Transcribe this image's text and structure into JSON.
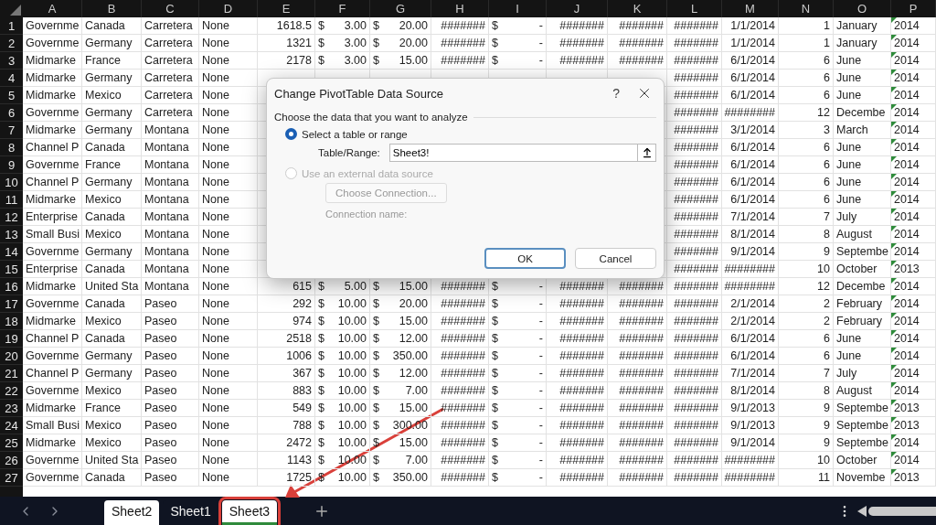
{
  "sheet": {
    "columns": [
      {
        "letter": "A"
      },
      {
        "letter": "B"
      },
      {
        "letter": "C"
      },
      {
        "letter": "D"
      },
      {
        "letter": "E"
      },
      {
        "letter": "F"
      },
      {
        "letter": "G"
      },
      {
        "letter": "H"
      },
      {
        "letter": "I"
      },
      {
        "letter": "J"
      },
      {
        "letter": "K"
      },
      {
        "letter": "L"
      },
      {
        "letter": "M"
      },
      {
        "letter": "N"
      },
      {
        "letter": "O"
      },
      {
        "letter": "P",
        "flagged": true
      }
    ],
    "rows": [
      {
        "number": "1",
        "cells": [
          "Governme",
          "Canada",
          "Carretera",
          "None",
          "1618.5",
          [
            "$",
            "3.00"
          ],
          [
            "$",
            "20.00"
          ],
          "#######",
          [
            "$",
            "-"
          ],
          "#######",
          "#######",
          "#######",
          "1/1/2014",
          "1",
          "January",
          "2014"
        ]
      },
      {
        "number": "2",
        "cells": [
          "Governme",
          "Germany",
          "Carretera",
          "None",
          "1321",
          [
            "$",
            "3.00"
          ],
          [
            "$",
            "20.00"
          ],
          "#######",
          [
            "$",
            "-"
          ],
          "#######",
          "#######",
          "#######",
          "1/1/2014",
          "1",
          "January",
          "2014"
        ]
      },
      {
        "number": "3",
        "cells": [
          "Midmarke",
          "France",
          "Carretera",
          "None",
          "2178",
          [
            "$",
            "3.00"
          ],
          [
            "$",
            "15.00"
          ],
          "#######",
          [
            "$",
            "-"
          ],
          "#######",
          "#######",
          "#######",
          "6/1/2014",
          "6",
          "June",
          "2014"
        ]
      },
      {
        "number": "4",
        "cells": [
          "Midmarke",
          "Germany",
          "Carretera",
          "None",
          null,
          null,
          null,
          null,
          null,
          null,
          null,
          "#######",
          "6/1/2014",
          "6",
          "June",
          "2014"
        ]
      },
      {
        "number": "5",
        "cells": [
          "Midmarke",
          "Mexico",
          "Carretera",
          "None",
          null,
          null,
          null,
          null,
          null,
          null,
          null,
          "#######",
          "6/1/2014",
          "6",
          "June",
          "2014"
        ]
      },
      {
        "number": "6",
        "cells": [
          "Governme",
          "Germany",
          "Carretera",
          "None",
          null,
          null,
          null,
          null,
          null,
          null,
          null,
          "#######",
          "########",
          "12",
          "Decembe",
          "2014"
        ]
      },
      {
        "number": "7",
        "cells": [
          "Midmarke",
          "Germany",
          "Montana",
          "None",
          null,
          null,
          null,
          null,
          null,
          null,
          null,
          "#######",
          "3/1/2014",
          "3",
          "March",
          "2014"
        ]
      },
      {
        "number": "8",
        "cells": [
          "Channel P",
          "Canada",
          "Montana",
          "None",
          null,
          null,
          null,
          null,
          null,
          null,
          null,
          "#######",
          "6/1/2014",
          "6",
          "June",
          "2014"
        ]
      },
      {
        "number": "9",
        "cells": [
          "Governme",
          "France",
          "Montana",
          "None",
          null,
          null,
          null,
          null,
          null,
          null,
          null,
          "#######",
          "6/1/2014",
          "6",
          "June",
          "2014"
        ]
      },
      {
        "number": "10",
        "cells": [
          "Channel P",
          "Germany",
          "Montana",
          "None",
          null,
          null,
          null,
          null,
          null,
          null,
          null,
          "#######",
          "6/1/2014",
          "6",
          "June",
          "2014"
        ]
      },
      {
        "number": "11",
        "cells": [
          "Midmarke",
          "Mexico",
          "Montana",
          "None",
          null,
          null,
          null,
          null,
          null,
          null,
          null,
          "#######",
          "6/1/2014",
          "6",
          "June",
          "2014"
        ]
      },
      {
        "number": "12",
        "cells": [
          "Enterprise",
          "Canada",
          "Montana",
          "None",
          null,
          null,
          null,
          null,
          null,
          null,
          null,
          "#######",
          "7/1/2014",
          "7",
          "July",
          "2014"
        ]
      },
      {
        "number": "13",
        "cells": [
          "Small Busi",
          "Mexico",
          "Montana",
          "None",
          null,
          null,
          null,
          null,
          null,
          null,
          null,
          "#######",
          "8/1/2014",
          "8",
          "August",
          "2014"
        ]
      },
      {
        "number": "14",
        "cells": [
          "Governme",
          "Germany",
          "Montana",
          "None",
          null,
          null,
          null,
          null,
          null,
          null,
          null,
          "#######",
          "9/1/2014",
          "9",
          "Septembe",
          "2014"
        ]
      },
      {
        "number": "15",
        "cells": [
          "Enterprise",
          "Canada",
          "Montana",
          "None",
          null,
          null,
          null,
          null,
          null,
          null,
          null,
          "#######",
          "########",
          "10",
          "October",
          "2013"
        ]
      },
      {
        "number": "16",
        "cells": [
          "Midmarke",
          "United Sta",
          "Montana",
          "None",
          "615",
          [
            "$",
            "5.00"
          ],
          [
            "$",
            "15.00"
          ],
          "#######",
          [
            "$",
            "-"
          ],
          "#######",
          "#######",
          "#######",
          "########",
          "12",
          "Decembe",
          "2014"
        ]
      },
      {
        "number": "17",
        "cells": [
          "Governme",
          "Canada",
          "Paseo",
          "None",
          "292",
          [
            "$",
            "10.00"
          ],
          [
            "$",
            "20.00"
          ],
          "#######",
          [
            "$",
            "-"
          ],
          "#######",
          "#######",
          "#######",
          "2/1/2014",
          "2",
          "February",
          "2014"
        ]
      },
      {
        "number": "18",
        "cells": [
          "Midmarke",
          "Mexico",
          "Paseo",
          "None",
          "974",
          [
            "$",
            "10.00"
          ],
          [
            "$",
            "15.00"
          ],
          "#######",
          [
            "$",
            "-"
          ],
          "#######",
          "#######",
          "#######",
          "2/1/2014",
          "2",
          "February",
          "2014"
        ]
      },
      {
        "number": "19",
        "cells": [
          "Channel P",
          "Canada",
          "Paseo",
          "None",
          "2518",
          [
            "$",
            "10.00"
          ],
          [
            "$",
            "12.00"
          ],
          "#######",
          [
            "$",
            "-"
          ],
          "#######",
          "#######",
          "#######",
          "6/1/2014",
          "6",
          "June",
          "2014"
        ]
      },
      {
        "number": "20",
        "cells": [
          "Governme",
          "Germany",
          "Paseo",
          "None",
          "1006",
          [
            "$",
            "10.00"
          ],
          [
            "$",
            "350.00"
          ],
          "#######",
          [
            "$",
            "-"
          ],
          "#######",
          "#######",
          "#######",
          "6/1/2014",
          "6",
          "June",
          "2014"
        ]
      },
      {
        "number": "21",
        "cells": [
          "Channel P",
          "Germany",
          "Paseo",
          "None",
          "367",
          [
            "$",
            "10.00"
          ],
          [
            "$",
            "12.00"
          ],
          "#######",
          [
            "$",
            "-"
          ],
          "#######",
          "#######",
          "#######",
          "7/1/2014",
          "7",
          "July",
          "2014"
        ]
      },
      {
        "number": "22",
        "cells": [
          "Governme",
          "Mexico",
          "Paseo",
          "None",
          "883",
          [
            "$",
            "10.00"
          ],
          [
            "$",
            "7.00"
          ],
          "#######",
          [
            "$",
            "-"
          ],
          "#######",
          "#######",
          "#######",
          "8/1/2014",
          "8",
          "August",
          "2014"
        ]
      },
      {
        "number": "23",
        "cells": [
          "Midmarke",
          "France",
          "Paseo",
          "None",
          "549",
          [
            "$",
            "10.00"
          ],
          [
            "$",
            "15.00"
          ],
          "#######",
          [
            "$",
            "-"
          ],
          "#######",
          "#######",
          "#######",
          "9/1/2013",
          "9",
          "Septembe",
          "2013"
        ]
      },
      {
        "number": "24",
        "cells": [
          "Small Busi",
          "Mexico",
          "Paseo",
          "None",
          "788",
          [
            "$",
            "10.00"
          ],
          [
            "$",
            "300.00"
          ],
          "#######",
          [
            "$",
            "-"
          ],
          "#######",
          "#######",
          "#######",
          "9/1/2013",
          "9",
          "Septembe",
          "2013"
        ]
      },
      {
        "number": "25",
        "cells": [
          "Midmarke",
          "Mexico",
          "Paseo",
          "None",
          "2472",
          [
            "$",
            "10.00"
          ],
          [
            "$",
            "15.00"
          ],
          "#######",
          [
            "$",
            "-"
          ],
          "#######",
          "#######",
          "#######",
          "9/1/2014",
          "9",
          "Septembe",
          "2014"
        ]
      },
      {
        "number": "26",
        "cells": [
          "Governme",
          "United Sta",
          "Paseo",
          "None",
          "1143",
          [
            "$",
            "10.00"
          ],
          [
            "$",
            "7.00"
          ],
          "#######",
          [
            "$",
            "-"
          ],
          "#######",
          "#######",
          "#######",
          "########",
          "10",
          "October",
          "2014"
        ]
      },
      {
        "number": "27",
        "cells": [
          "Governme",
          "Canada",
          "Paseo",
          "None",
          "1725",
          [
            "$",
            "10.00"
          ],
          [
            "$",
            "350.00"
          ],
          "#######",
          [
            "$",
            "-"
          ],
          "#######",
          "#######",
          "#######",
          "########",
          "11",
          "Novembe",
          "2013"
        ]
      }
    ]
  },
  "dialog": {
    "title": "Change PivotTable Data Source",
    "help": "?",
    "section_label": "Choose the data that you want to analyze",
    "options": [
      {
        "label": "Select a table or range",
        "selected": true,
        "disabled": false
      },
      {
        "label": "Use an external data source",
        "selected": false,
        "disabled": true
      }
    ],
    "range_label": "Table/Range:",
    "range_value": "Sheet3!",
    "connection_button": {
      "label": "Choose Connection...",
      "disabled": true
    },
    "connection_name_label": "Connection name:",
    "buttons": [
      {
        "label": "OK",
        "default": true
      },
      {
        "label": "Cancel",
        "default": false
      }
    ]
  },
  "sheet_tabs": [
    {
      "label": "Sheet2",
      "selected": false,
      "grouped": true,
      "highlighted": false
    },
    {
      "label": "Sheet1",
      "selected": false,
      "grouped": false,
      "highlighted": false
    },
    {
      "label": "Sheet3",
      "selected": true,
      "grouped": true,
      "highlighted": true
    }
  ]
}
